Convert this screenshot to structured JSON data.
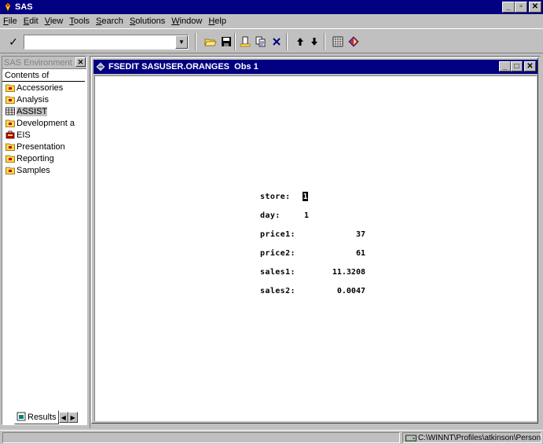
{
  "app": {
    "title": "SAS"
  },
  "menubar": {
    "items": [
      {
        "first": "F",
        "rest": "ile"
      },
      {
        "first": "E",
        "rest": "dit"
      },
      {
        "first": "V",
        "rest": "iew"
      },
      {
        "first": "T",
        "rest": "ools"
      },
      {
        "first": "S",
        "rest": "earch"
      },
      {
        "first": "S",
        "rest": "olutions"
      },
      {
        "first": "W",
        "rest": "indow"
      },
      {
        "first": "H",
        "rest": "elp"
      }
    ]
  },
  "toolbar": {
    "command_value": "",
    "check_icon": "checkmark-icon"
  },
  "explorer": {
    "title": "SAS Environment",
    "contents_label": "Contents of",
    "items": [
      {
        "label": "Accessories",
        "icon": "folder-icon"
      },
      {
        "label": "Analysis",
        "icon": "folder-icon"
      },
      {
        "label": "ASSIST",
        "icon": "assist-icon",
        "selected": true
      },
      {
        "label": "Development a",
        "icon": "folder-icon"
      },
      {
        "label": "EIS",
        "icon": "eis-icon"
      },
      {
        "label": "Presentation",
        "icon": "folder-icon"
      },
      {
        "label": "Reporting",
        "icon": "folder-icon"
      },
      {
        "label": "Samples",
        "icon": "folder-icon"
      }
    ],
    "results_tab": "Results"
  },
  "fsedit": {
    "title": "FSEDIT SASUSER.ORANGES  Obs 1",
    "fields": {
      "store_label": "store:",
      "store_value": "1",
      "day_label": "day:",
      "day_value": "1",
      "price1_label": "price1:",
      "price1_value": "37",
      "price2_label": "price2:",
      "price2_value": "61",
      "sales1_label": "sales1:",
      "sales1_value": "11.3208",
      "sales2_label": "sales2:",
      "sales2_value": "0.0047"
    }
  },
  "status": {
    "path": "C:\\WINNT\\Profiles\\atkinson\\Person"
  },
  "colors": {
    "titlebar": "#000080",
    "face": "#c0c0c0"
  }
}
